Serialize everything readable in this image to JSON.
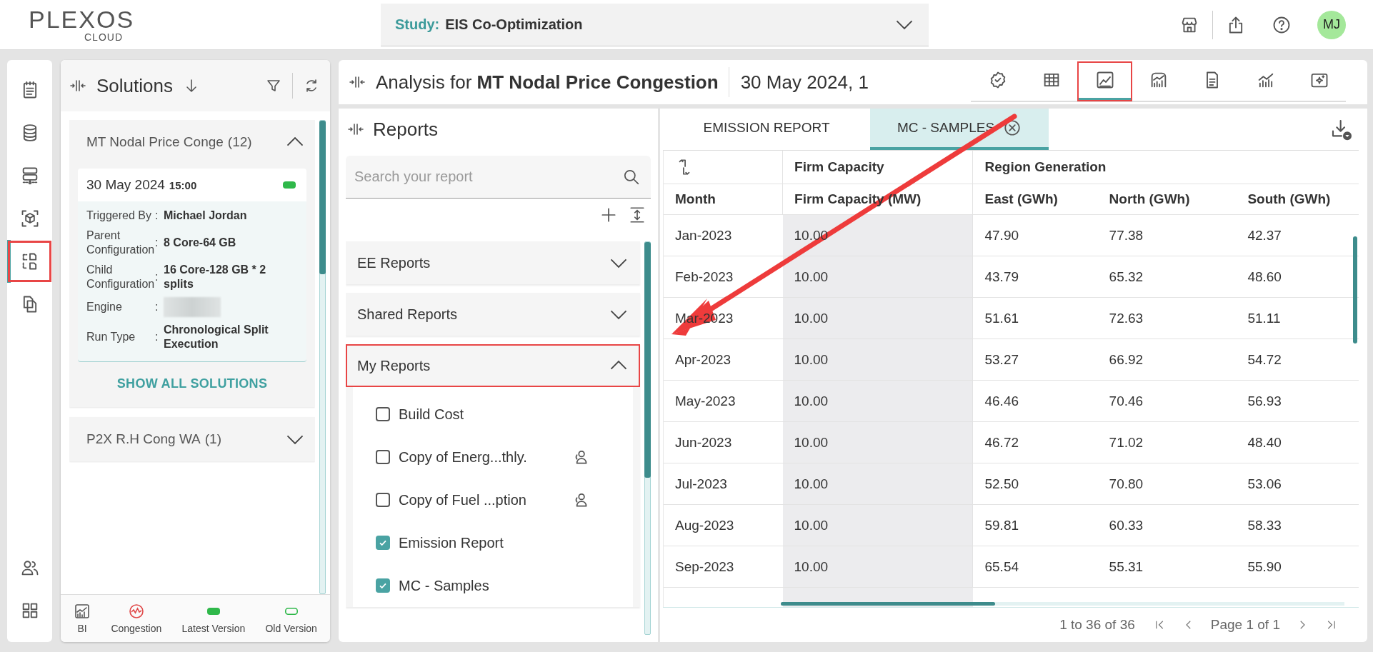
{
  "header": {
    "logo": {
      "name": "PLEXOS",
      "sub": "CLOUD"
    },
    "study": {
      "label": "Study:",
      "value": "EIS Co-Optimization"
    },
    "user": {
      "initials": "MJ"
    }
  },
  "rail": {
    "items": [
      {
        "selected": false,
        "highlighted": false
      },
      {
        "selected": false,
        "highlighted": false
      },
      {
        "selected": false,
        "highlighted": false
      },
      {
        "selected": false,
        "highlighted": false
      },
      {
        "selected": true,
        "highlighted": true
      },
      {
        "selected": false,
        "highlighted": false
      }
    ]
  },
  "solutions": {
    "title": "Solutions",
    "groups": [
      {
        "title": "MT Nodal Price Conge",
        "count": "(12)",
        "expanded": true,
        "run": {
          "date": "30 May 2024",
          "time": "15:00",
          "latest": true
        },
        "details": [
          {
            "label": "Triggered By",
            "colon": ":",
            "value": "Michael Jordan",
            "redacted": false
          },
          {
            "label": "Parent Configuration",
            "colon": ":",
            "value": "8 Core-64 GB",
            "redacted": false
          },
          {
            "label": "Child Configuration",
            "colon": ":",
            "value": "16 Core-128 GB * 2 splits",
            "redacted": false
          },
          {
            "label": "Engine",
            "colon": ":",
            "redacted": true
          },
          {
            "label": "Run Type",
            "colon": ":",
            "value": "Chronological Split Execution",
            "redacted": false
          }
        ],
        "show_all": "SHOW ALL SOLUTIONS"
      },
      {
        "title": "P2X R.H Cong WA",
        "count": "(1)",
        "expanded": false
      }
    ],
    "legend": [
      {
        "kind": "bi",
        "label": "BI"
      },
      {
        "kind": "congestion",
        "label": "Congestion"
      },
      {
        "kind": "latest",
        "label": "Latest Version"
      },
      {
        "kind": "old",
        "label": "Old Version"
      }
    ]
  },
  "analysis": {
    "prefix": "Analysis for",
    "name": "MT Nodal Price Congestion",
    "date": "30 May 2024, 1",
    "toolbar": [
      {
        "selected": false,
        "highlighted": false
      },
      {
        "selected": false,
        "highlighted": false
      },
      {
        "selected": true,
        "highlighted": true
      },
      {
        "selected": false,
        "highlighted": false
      },
      {
        "selected": false,
        "highlighted": false
      },
      {
        "selected": false,
        "highlighted": false
      },
      {
        "selected": false,
        "highlighted": false
      }
    ]
  },
  "reports": {
    "title": "Reports",
    "search": {
      "placeholder": "Search your report"
    },
    "sections": [
      {
        "title": "EE Reports",
        "expanded": false,
        "highlighted": false
      },
      {
        "title": "Shared Reports",
        "expanded": false,
        "highlighted": false
      },
      {
        "title": "My Reports",
        "expanded": true,
        "highlighted": true,
        "items": [
          {
            "label": "Build Cost",
            "checked": false,
            "shared": false
          },
          {
            "label": "Copy of Energ...thly.",
            "checked": false,
            "shared": true
          },
          {
            "label": "Copy of Fuel ...ption",
            "checked": false,
            "shared": true
          },
          {
            "label": "Emission Report",
            "checked": true,
            "shared": false
          },
          {
            "label": "MC - Samples",
            "checked": true,
            "shared": false
          }
        ]
      }
    ]
  },
  "table": {
    "tabs": [
      {
        "label": "EMISSION REPORT",
        "selected": false,
        "closable": false
      },
      {
        "label": "MC - SAMPLES",
        "selected": true,
        "closable": true
      }
    ],
    "first_column": "Month",
    "groups": [
      {
        "label": "Firm Capacity",
        "columns": [
          "Firm Capacity (MW)"
        ]
      },
      {
        "label": "Region Generation",
        "columns": [
          "East (GWh)",
          "North (GWh)",
          "South (GWh)"
        ]
      }
    ],
    "rows": [
      [
        "Jan-2023",
        "10.00",
        "47.90",
        "77.38",
        "42.37"
      ],
      [
        "Feb-2023",
        "10.00",
        "43.79",
        "65.32",
        "48.60"
      ],
      [
        "Mar-2023",
        "10.00",
        "51.61",
        "72.63",
        "51.11"
      ],
      [
        "Apr-2023",
        "10.00",
        "53.27",
        "66.92",
        "54.72"
      ],
      [
        "May-2023",
        "10.00",
        "46.46",
        "70.46",
        "56.93"
      ],
      [
        "Jun-2023",
        "10.00",
        "46.72",
        "71.02",
        "48.40"
      ],
      [
        "Jul-2023",
        "10.00",
        "52.50",
        "70.80",
        "53.06"
      ],
      [
        "Aug-2023",
        "10.00",
        "59.81",
        "60.33",
        "58.33"
      ],
      [
        "Sep-2023",
        "10.00",
        "65.54",
        "55.31",
        "55.90"
      ]
    ],
    "range": "1 to 36 of 36",
    "page": "Page 1 of 1"
  },
  "annotation_arrow": true
}
